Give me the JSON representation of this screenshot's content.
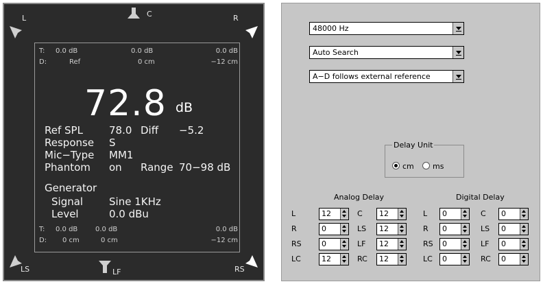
{
  "meter": {
    "speakers": {
      "l": "L",
      "c": "C",
      "r": "R",
      "ls": "LS",
      "lf": "LF",
      "rs": "RS"
    },
    "top": {
      "t_label": "T:",
      "t_left": "0.0 dB",
      "t_center": "0.0 dB",
      "t_right": "0.0 dB",
      "d_label": "D:",
      "d_left": "Ref",
      "d_center": "0 cm",
      "d_right": "−12 cm"
    },
    "level_value": "72.8",
    "level_unit": "dB",
    "ref_spl_label": "Ref SPL",
    "ref_spl_value": "78.0",
    "diff_label": "Diff",
    "diff_value": "−5.2",
    "response_label": "Response",
    "response_value": "S",
    "mic_type_label": "Mic−Type",
    "mic_type_value": "MM1",
    "phantom_label": "Phantom",
    "phantom_value": "on",
    "range_label": "Range",
    "range_value": "70−98 dB",
    "generator_label": "Generator",
    "signal_label": "Signal",
    "signal_value": "Sine 1KHz",
    "gen_level_label": "Level",
    "gen_level_value": "0.0 dBu",
    "bottom": {
      "t_label": "T:",
      "t_left": "0.0 dB",
      "t_center": "0.0 dB",
      "t_right": "0.0 dB",
      "d_label": "D:",
      "d_left": "0 cm",
      "d_center": "0 cm",
      "d_right": "−12 cm"
    }
  },
  "settings": {
    "sample_rate": "48000 Hz",
    "search_mode": "Auto Search",
    "ad_sync": "A−D follows external reference",
    "delay_unit": {
      "title": "Delay Unit",
      "cm": "cm",
      "ms": "ms",
      "selected": "cm"
    },
    "analog_delay": {
      "title": "Analog Delay",
      "left_labels": [
        "L",
        "R",
        "RS",
        "LC"
      ],
      "left_values": [
        "12",
        "0",
        "0",
        "12"
      ],
      "right_labels": [
        "C",
        "LS",
        "LF",
        "RC"
      ],
      "right_values": [
        "12",
        "12",
        "12",
        "12"
      ]
    },
    "digital_delay": {
      "title": "Digital Delay",
      "left_labels": [
        "L",
        "R",
        "RS",
        "LC"
      ],
      "left_values": [
        "0",
        "0",
        "0",
        "0"
      ],
      "right_labels": [
        "C",
        "LS",
        "LF",
        "RC"
      ],
      "right_values": [
        "0",
        "0",
        "0",
        "0"
      ]
    }
  }
}
